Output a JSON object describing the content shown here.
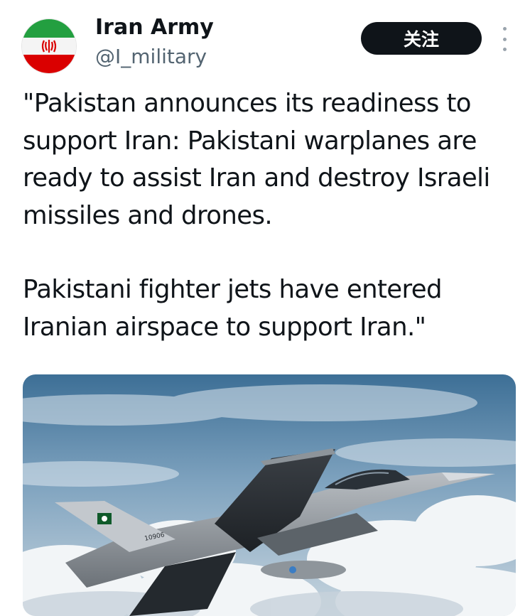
{
  "tweet": {
    "author": {
      "name": "Iran Army",
      "handle": "@I_military",
      "avatar_icon": "iran-flag-icon"
    },
    "follow_label": "关注",
    "more_icon": "more-vertical-icon",
    "paragraphs": [
      "\"Pakistan announces its readiness to support Iran: Pakistani warplanes are ready to assist Iran and destroy Israeli missiles and drones.",
      "Pakistani fighter jets have entered Iranian airspace to support Iran.\""
    ],
    "media": {
      "aircraft_tail_number": "10906"
    }
  },
  "colors": {
    "follow_bg": "#0f1419",
    "handle": "#536471",
    "flag_green": "#239f40",
    "flag_red": "#da0000"
  }
}
